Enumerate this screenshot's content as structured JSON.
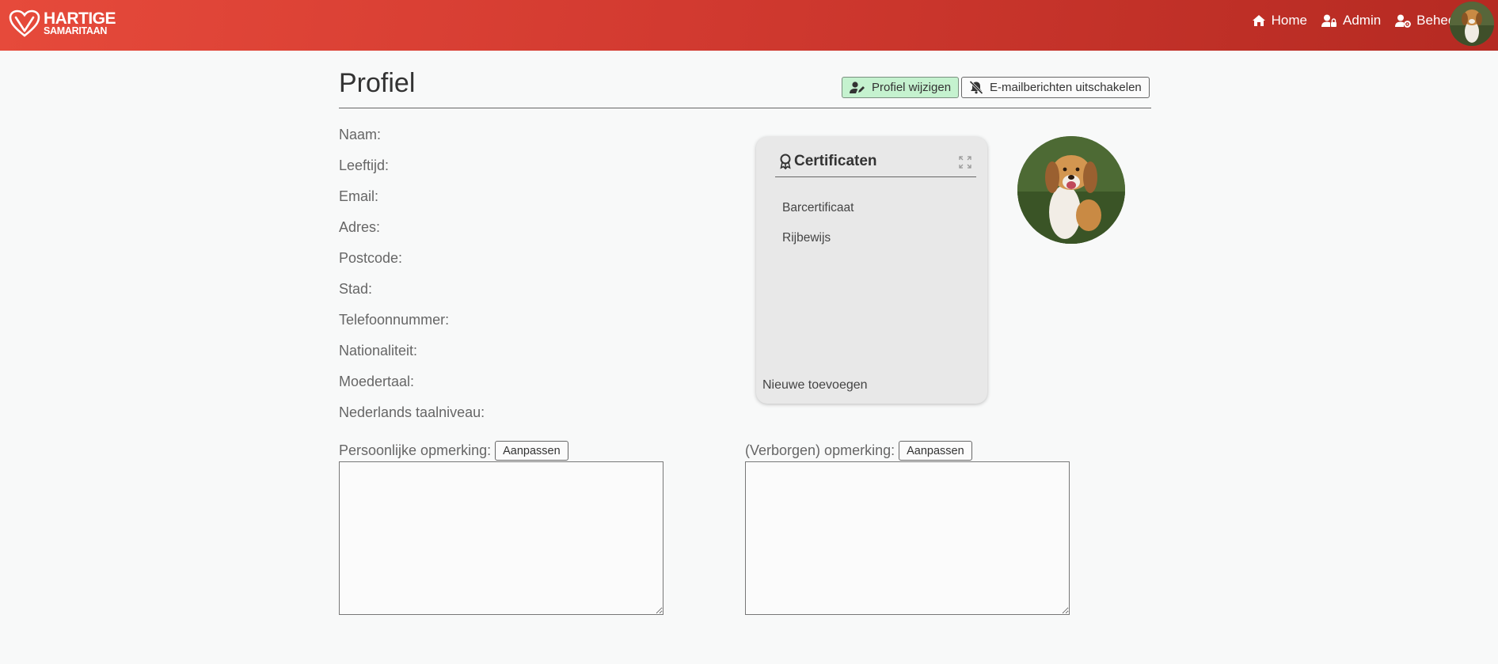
{
  "navbar": {
    "logo": {
      "line1": "HARTIGE",
      "line2": "SAMARITAAN"
    },
    "links": [
      {
        "label": "Home",
        "icon": "home-icon"
      },
      {
        "label": "Admin",
        "icon": "user-lock-icon"
      },
      {
        "label": "Beheer",
        "icon": "user-gear-icon"
      }
    ],
    "avatar": "user-avatar-dog"
  },
  "page": {
    "title": "Profiel",
    "edit_button": "Profiel wijzigen",
    "email_button": "E-mailberichten uitschakelen"
  },
  "fields": [
    {
      "label": "Naam:"
    },
    {
      "label": "Leeftijd:"
    },
    {
      "label": "Email:"
    },
    {
      "label": "Adres:"
    },
    {
      "label": "Postcode:"
    },
    {
      "label": "Stad:"
    },
    {
      "label": "Telefoonnummer:"
    },
    {
      "label": "Nationaliteit:"
    },
    {
      "label": "Moedertaal:"
    },
    {
      "label": "Nederlands taalniveau:"
    }
  ],
  "certificates": {
    "title": "Certificaten",
    "items": [
      "Barcertificaat",
      "Rijbewijs"
    ],
    "add_label": "Nieuwe toevoegen"
  },
  "remarks": {
    "personal_label": "Persoonlijke opmerking:",
    "personal_button": "Aanpassen",
    "personal_value": "",
    "hidden_label": "(Verborgen) opmerking:",
    "hidden_button": "Aanpassen",
    "hidden_value": ""
  },
  "colors": {
    "navbar": "#d23a30",
    "edit_button_bg": "#c5f2cf",
    "card_bg": "#e8e8e8",
    "page_bg": "#f8f9f9"
  }
}
